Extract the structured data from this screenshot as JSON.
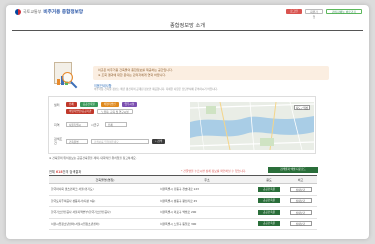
{
  "header": {
    "ministry": "국토교통부",
    "site_title": "비주거용 종합정보망",
    "page_title": "종합정보망 소개",
    "links": [
      "로그인",
      "회원가입",
      "관리자메뉴 바로가기"
    ]
  },
  "notice": {
    "lines": [
      "이곳은 비주거용 건축물의 종합정보를 제공하는 공간입니다.",
      "※ 조회 결과에 대한 문의는 관리자에게 연락 바랍니다."
    ]
  },
  "tip": {
    "title": "이용안내사항",
    "text": "비주거용 건축물 정보는 매년 갱신되며 공개된 정보만 제공합니다. 자세한 사항은 담당부서에 문의하시기 바랍니다."
  },
  "search": {
    "filter_label": "필터",
    "chips": [
      "전체",
      "공공건축물",
      "비영리법인",
      "업무시설"
    ],
    "chips_row2": [
      "비영리법인/공공기관",
      "노유자, 교육 및 연구시설"
    ],
    "region_label": "지역",
    "region_select": "서울특별시",
    "district_label": "시군구",
    "district_select": "전체",
    "keyword_label": "검색조건",
    "keyword_select": "건축물명",
    "keyword_placeholder": "검색어를 입력해주세요",
    "search_button": "검색",
    "map_control": "지도 / 위성"
  },
  "disclaimer": "※ 건축물의 위치정보는 공공건축물을 제외, 대략적인 위치임을 참고하세요.",
  "results": {
    "count_prefix": "전체 ",
    "count_value": "618",
    "count_suffix": "건의 검색결과",
    "red_note": "* 건물명을 누르시면 상세 정보를 확인하실 수 있습니다.",
    "excel_button": "검색결과 엑셀 다운로드",
    "columns": [
      "건축물명(명칭)",
      "주소",
      "용도",
      "비고"
    ],
    "rows": [
      {
        "name": "한국마사회 렛츠런파크 서울(경기도)",
        "addr": "서울특별시 강동구 천호대로 123",
        "status": "공공건축물",
        "action": "상세보기"
      },
      {
        "name": "한국토지주택공사 성동지사(지상 3층)",
        "addr": "서울특별시 성동구 왕십리로 45",
        "status": "공공건축물",
        "action": "상세보기"
      },
      {
        "name": "한국가스안전공사 서울지역본부(한국가스안전공사)",
        "addr": "서울특별시 마포구 백범로 200",
        "status": "공공건축물",
        "action": "상세보기"
      },
      {
        "name": "서울시립청소년센터(서울시립청소년센터)",
        "addr": "서울특별시 노원구 동일로 300",
        "status": "공공건축물",
        "action": "상세보기"
      }
    ]
  },
  "colors": {
    "brand_blue": "#1f4ea3",
    "accent_red": "#d9534f",
    "accent_green": "#2a6e3a"
  }
}
